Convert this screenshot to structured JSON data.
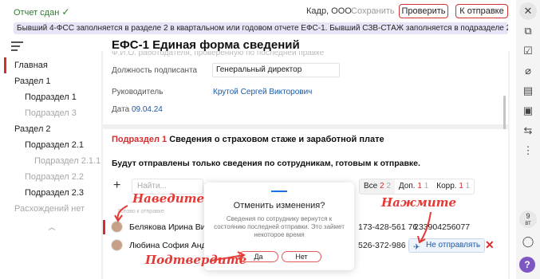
{
  "header": {
    "status": "Отчет сдан",
    "org": "Кадр, ООО",
    "save": "Сохранить",
    "check": "Проверить",
    "send": "К отправке"
  },
  "banner": "Бывший 4-ФСС заполняется в разделе 2 в квартальном или годовом отчете ЕФС-1. Бывший СЗВ-СТАЖ заполняется в подразделе 2",
  "title": "ЕФС-1 Единая форма сведений",
  "nav": [
    {
      "label": "Главная"
    },
    {
      "label": "Раздел 1"
    },
    {
      "label": "Подраздел 1"
    },
    {
      "label": "Подраздел 3"
    },
    {
      "label": "Раздел 2"
    },
    {
      "label": "Подраздел 2.1"
    },
    {
      "label": "Подраздел 2.1.1"
    },
    {
      "label": "Подраздел 2.2"
    },
    {
      "label": "Подраздел 2.3"
    },
    {
      "label": "Расхождений нет"
    }
  ],
  "card1": {
    "clipped": "Ф.И.О. работодателя, проверенную по последней правке",
    "position_label": "Должность подписанта",
    "position_value": "Генеральный директор",
    "manager_label": "Руководитель",
    "manager_value": "Крутой Сергей Викторович",
    "date_label": "Дата",
    "date_value": "09.04.24"
  },
  "section": {
    "prefix": "Подраздел 1",
    "title": "Сведения о страховом стаже и заработной плате",
    "warning": "Будут отправлены только сведения по сотрудникам, готовым к отправке.",
    "search_placeholder": "Найти...",
    "filters": {
      "all": "Все",
      "all_a": "2",
      "all_b": "2",
      "extra": "Доп.",
      "extra_a": "1",
      "extra_b": "1",
      "corr": "Корр.",
      "corr_a": "1",
      "corr_b": "1"
    },
    "employee_sub": "Готово к отправке",
    "employees": [
      {
        "name": "Белякова Ирина Викт",
        "phone": "173-428-561 76",
        "snils": "233904256077"
      },
      {
        "name": "Любина София Андреевна",
        "phone": "526-372-986"
      }
    ],
    "not_send": "Не отправлять"
  },
  "dialog": {
    "title": "Отменить изменения?",
    "text": "Сведения по сотруднику вернутся к состоянию последней отправки. Это займет некоторое время",
    "yes": "Да",
    "no": "Нет"
  },
  "annotations": {
    "hover": "Наведите",
    "click": "Нажмите",
    "confirm": "Подтвердите"
  },
  "toolbar": {
    "badge": "9",
    "badge_sub": "ВТ",
    "icons": [
      "close-icon",
      "copy-icon",
      "edit-check-icon",
      "paperclip-icon",
      "document-icon",
      "save-icon",
      "import-icon",
      "more-icon",
      "chat-icon",
      "help-icon"
    ]
  }
}
